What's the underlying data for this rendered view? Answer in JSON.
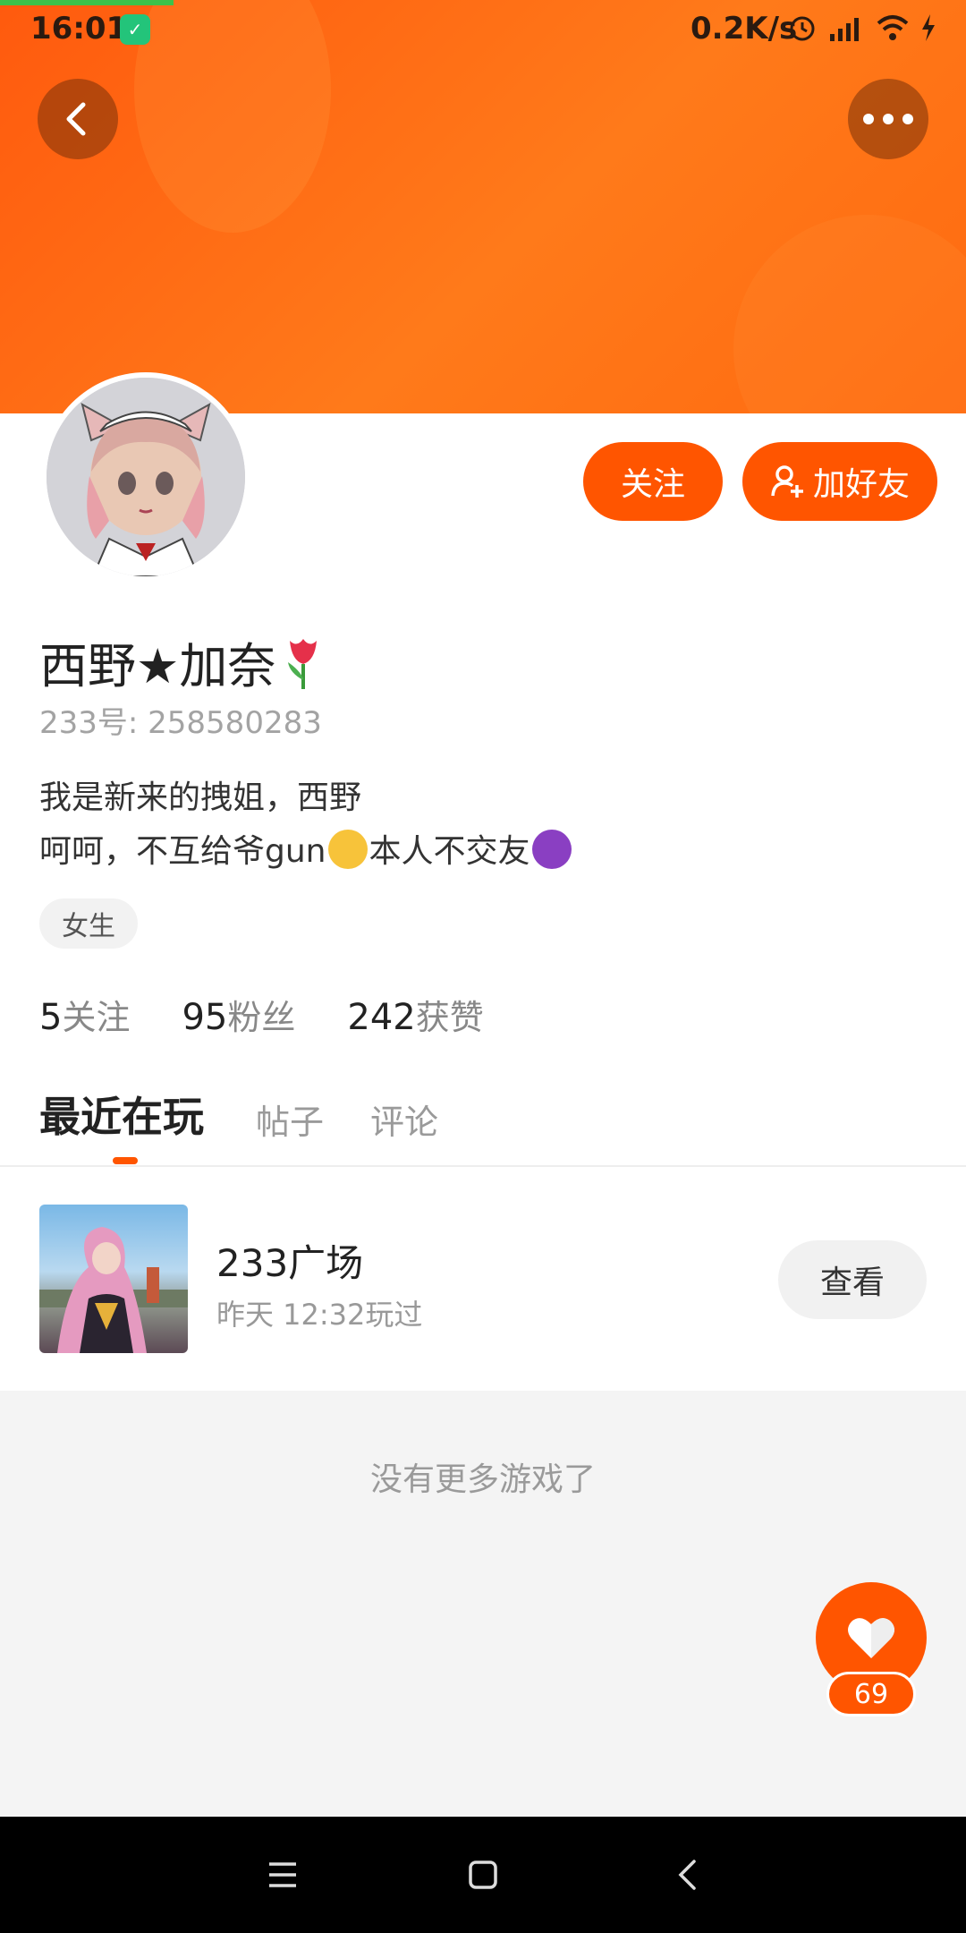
{
  "status_bar": {
    "time": "16:01",
    "network_speed": "0.2K/s",
    "icons": [
      "vpn-shield-icon",
      "alarm-icon",
      "hd-signal-icon",
      "wifi-icon",
      "charging-icon"
    ]
  },
  "header": {
    "back_icon": "chevron-left-icon",
    "more_icon": "more-dots-icon"
  },
  "profile": {
    "name": "西野★加奈",
    "name_emoji": "tulip",
    "id_line": "233号: 258580283",
    "bio_line1": "我是新来的拽姐，西野",
    "bio_line2_a": "呵呵，不互给爷gun",
    "bio_line2_b": "本人不交友",
    "gender_tag": "女生",
    "follow_button": "关注",
    "add_friend_button": "加好友"
  },
  "stats": [
    {
      "num": "5",
      "label": "关注"
    },
    {
      "num": "95",
      "label": "粉丝"
    },
    {
      "num": "242",
      "label": "获赞"
    }
  ],
  "tabs": [
    "最近在玩",
    "帖子",
    "评论"
  ],
  "recent_game": {
    "title": "233广场",
    "played": "昨天 12:32玩过",
    "view_button": "查看"
  },
  "footer_text": "没有更多游戏了",
  "like": {
    "count": "69"
  },
  "colors": {
    "accent": "#ff5500",
    "banner": "#ff6a10"
  }
}
